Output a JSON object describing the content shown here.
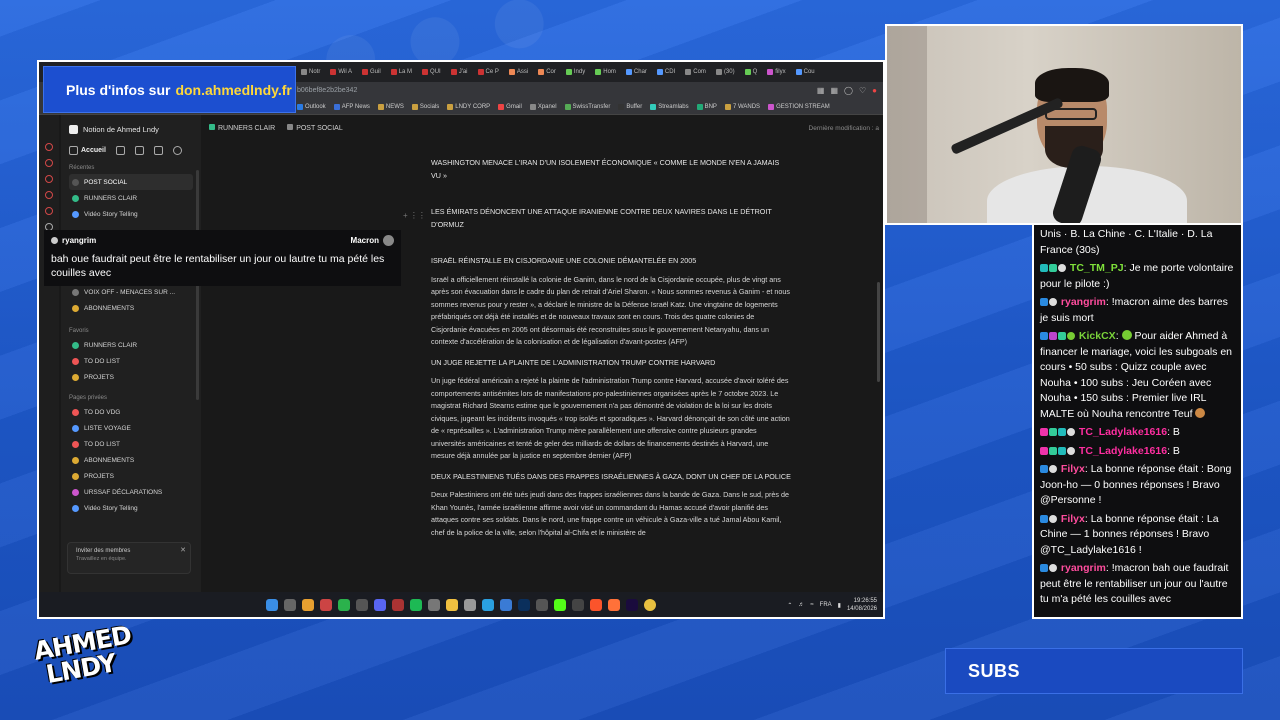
{
  "promo": {
    "prefix": "Plus d'infos sur",
    "link": "don.ahmedlndy.fr"
  },
  "browser": {
    "tabs": [
      "Notr",
      "Wil A",
      "Guil",
      "La M",
      "QUI",
      "J'ai",
      "Ce P",
      "Assi",
      "Cor",
      "Indy",
      "Hom",
      "Char",
      "CDI",
      "Com",
      "(30)",
      "Q",
      "filyx",
      "Cou"
    ],
    "address": "b06bef8e2b2be342",
    "bookmarks": [
      "Outlook",
      "AFP News",
      "NEWS",
      "Socials",
      "LNDY CORP",
      "Gmail",
      "Xpanel",
      "SwissTransfer",
      "Buffer",
      "Streamlabs",
      "BNP",
      "7 WANDS",
      "GESTION STREAM"
    ]
  },
  "sidebar": {
    "workspace": "Notion de Ahmed Lndy",
    "home": "Accueil",
    "recent_label": "Récentes",
    "recent": [
      "POST SOCIAL",
      "RUNNERS CLAIR",
      "Vidéo Story Telling"
    ],
    "other_items": [
      "VOIX OFF - MENACES SUR ...",
      "ABONNEMENTS"
    ],
    "favorites_label": "Favoris",
    "favorites": [
      "RUNNERS CLAIR",
      "TO DO LIST",
      "PROJETS"
    ],
    "private_label": "Pages privées",
    "private": [
      "TO DO VDG",
      "LISTE VOYAGE",
      "TO DO LIST",
      "ABONNEMENTS",
      "PROJETS",
      "URSSAF DÉCLARATIONS",
      "Vidéo Story Telling"
    ],
    "invite_title": "Inviter des membres",
    "invite_sub": "Travaillez en équipe."
  },
  "breadcrumb": [
    "RUNNERS CLAIR",
    "POST SOCIAL"
  ],
  "last_modified": "Dernière modification : a",
  "doc": {
    "h1": "WASHINGTON MENACE L'IRAN D'UN ISOLEMENT ÉCONOMIQUE « COMME LE MONDE N'EN A JAMAIS VU »",
    "h2": "LES ÉMIRATS DÉNONCENT UNE ATTAQUE IRANIENNE CONTRE DEUX NAVIRES DANS LE DÉTROIT D'ORMUZ",
    "h3": "ISRAËL RÉINSTALLE EN CISJORDANIE UNE COLONIE DÉMANTELÉE EN 2005",
    "p3": "Israël a officiellement réinstallé la colonie de Ganim, dans le nord de la Cisjordanie occupée, plus de vingt ans après son évacuation dans le cadre du plan de retrait d'Ariel Sharon. « Nous sommes revenus à Ganim - et nous sommes revenus pour y rester », a déclaré le ministre de la Défense Israël Katz. Une vingtaine de logements préfabriqués ont déjà été installés et de nouveaux travaux sont en cours. Trois des quatre colonies de Cisjordanie évacuées en 2005 ont désormais été reconstruites sous le gouvernement Netanyahu, dans un contexte d'accélération de la colonisation et de légalisation d'avant-postes (AFP)",
    "h4": "UN JUGE REJETTE LA PLAINTE DE L'ADMINISTRATION TRUMP CONTRE HARVARD",
    "p4": "Un juge fédéral américain a rejeté la plainte de l'administration Trump contre Harvard, accusée d'avoir toléré des comportements antisémites lors de manifestations pro-palestiniennes organisées après le 7 octobre 2023. Le magistrat Richard Stearns estime que le gouvernement n'a pas démontré de violation de la loi sur les droits civiques, jugeant les incidents invoqués « trop isolés et sporadiques ». Harvard dénonçait de son côté une action de « représailles ». L'administration Trump mène parallèlement une offensive contre plusieurs grandes universités américaines et tenté de geler des milliards de dollars de financements destinés à Harvard, une mesure déjà annulée par la justice en septembre dernier (AFP)",
    "h5": "DEUX PALESTINIENS TUÉS DANS DES FRAPPES ISRAÉLIENNES À GAZA, DONT UN CHEF DE LA POLICE",
    "p5": "Deux Palestiniens ont été tués jeudi dans des frappes israéliennes dans la bande de Gaza. Dans le sud, près de Khan Younès, l'armée israélienne affirme avoir visé un commandant du Hamas accusé d'avoir planifié des attaques contre ses soldats. Dans le nord, une frappe contre un véhicule à Gaza-ville a tué Jamal Abou Kamil, chef de la police de la ville, selon l'hôpital al-Chifa et le ministère de"
  },
  "taskbar": {
    "lang": "FRA",
    "time": "19:26:55",
    "date": "14/08/2026"
  },
  "popup": {
    "user": "ryangrim",
    "tag": "Macron",
    "message": "bah oue faudrait peut être le rentabiliser un jour ou lautre tu ma pété les couilles avec"
  },
  "chat": {
    "messages": [
      {
        "user": "",
        "text": "Unis · B. La Chine · C. L'Italie · D. La France (30s)"
      },
      {
        "user": "TC_TM_PJ",
        "text": "Je me porte volontaire pour le pilote :)"
      },
      {
        "user": "ryangrim",
        "text": "!macron aime des barres je suis mort"
      },
      {
        "user": "KickCX",
        "text": "Pour aider Ahmed à financer le mariage, voici les subgoals en cours • 50 subs : Quizz couple avec Nouha • 100 subs : Jeu Coréen avec Nouha • 150 subs : Premier live IRL MALTE où Nouha rencontre Teuf"
      },
      {
        "user": "TC_Ladylake1616",
        "text": "B"
      },
      {
        "user": "TC_Ladylake1616",
        "text": "B"
      },
      {
        "user": "Filyx",
        "text": "La bonne réponse était : Bong Joon-ho — 0 bonnes réponses ! Bravo @Personne !"
      },
      {
        "user": "Filyx",
        "text": "La bonne réponse était : La Chine — 1 bonnes réponses ! Bravo @TC_Ladylake1616 !"
      },
      {
        "user": "ryangrim",
        "text": "!macron bah oue faudrait peut être le rentabiliser un jour ou l'autre tu m'a pété les couilles avec"
      }
    ]
  },
  "logo": {
    "line1": "AHMED",
    "line2": "LNDY"
  },
  "subs": {
    "label": "SUBS"
  },
  "colors": {
    "overlay_blue": "#1f5fd6",
    "promo_yellow": "#ffd83a",
    "chat_bg": "#0e0e10"
  }
}
